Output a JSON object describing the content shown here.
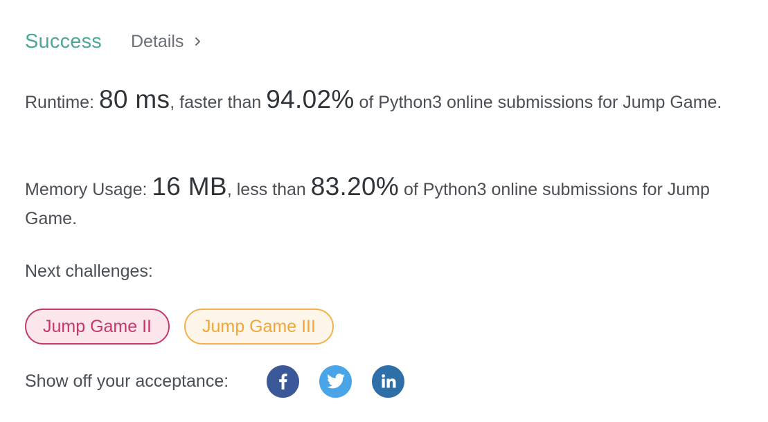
{
  "result": {
    "status": "Success",
    "details_label": "Details"
  },
  "runtime": {
    "label": "Runtime:",
    "value": "80 ms",
    "comparison_text": ", faster than",
    "percent": "94.02%",
    "suffix": "of Python3 online submissions for Jump Game."
  },
  "memory": {
    "label": "Memory Usage:",
    "value": "16 MB",
    "comparison_text": ", less than",
    "percent": "83.20%",
    "suffix": "of Python3 online submissions for Jump Game."
  },
  "next_challenges": {
    "label": "Next challenges:",
    "items": [
      {
        "label": "Jump Game II",
        "difficulty": "hard"
      },
      {
        "label": "Jump Game III",
        "difficulty": "medium"
      }
    ]
  },
  "share": {
    "label": "Show off your acceptance:",
    "networks": [
      {
        "icon": "facebook-icon",
        "color": "#3b5998"
      },
      {
        "icon": "twitter-icon",
        "color": "#4aa5e8"
      },
      {
        "icon": "linkedin-icon",
        "color": "#2f6fa8"
      }
    ]
  },
  "colors": {
    "success": "#4ea796",
    "hard_border": "#c4386a",
    "hard_fill": "#fbe6ec",
    "medium_border": "#f4b04a",
    "medium_fill": "#fff6ea"
  }
}
